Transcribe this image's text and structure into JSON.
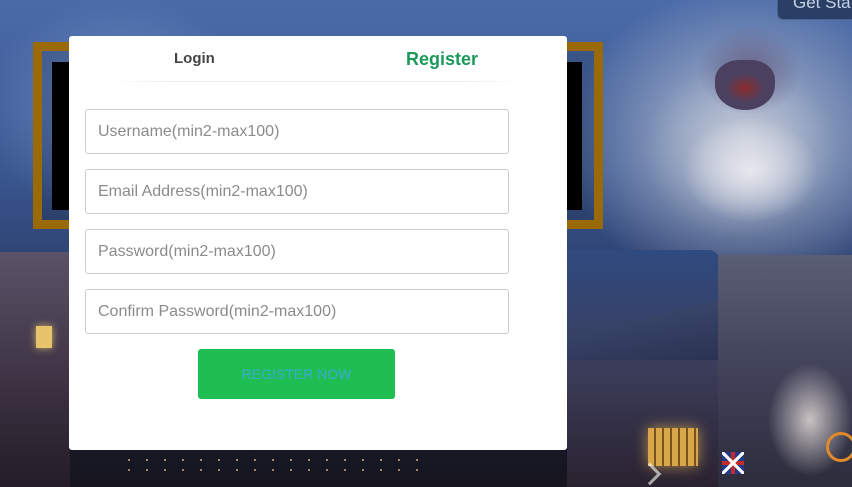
{
  "background": {
    "top_button_label": "Get Sta"
  },
  "modal": {
    "tabs": [
      {
        "label": "Login",
        "active": false
      },
      {
        "label": "Register",
        "active": true
      }
    ],
    "fields": {
      "username": {
        "placeholder": "Username(min2-max100)",
        "value": ""
      },
      "email": {
        "placeholder": "Email Address(min2-max100)",
        "value": ""
      },
      "password": {
        "placeholder": "Password(min2-max100)",
        "value": ""
      },
      "confirm_password": {
        "placeholder": "Confirm Password(min2-max100)",
        "value": ""
      }
    },
    "submit_label": "REGISTER NOW"
  },
  "colors": {
    "active_tab": "#1b9a5b",
    "button_bg": "#1fbe52",
    "button_text": "#3aa8d8",
    "frame": "#9a6a08"
  }
}
